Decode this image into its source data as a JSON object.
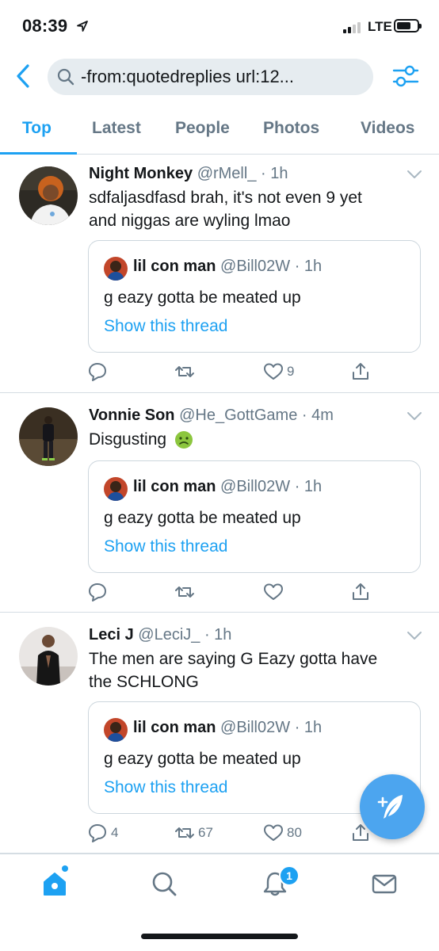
{
  "status_bar": {
    "time": "08:39",
    "network": "LTE",
    "signal_bars": 2,
    "signal_bars_max": 4
  },
  "search": {
    "query": "-from:quotedreplies url:12..."
  },
  "tabs": [
    {
      "label": "Top",
      "active": true
    },
    {
      "label": "Latest",
      "active": false
    },
    {
      "label": "People",
      "active": false
    },
    {
      "label": "Photos",
      "active": false
    },
    {
      "label": "Videos",
      "active": false
    }
  ],
  "tweets": [
    {
      "name": "Night Monkey",
      "handle": "@rMell_",
      "time": "· 1h",
      "lines": [
        "sdfaljasdfasd brah, it's not even 9 yet",
        "and niggas are wyling lmao"
      ],
      "quote": {
        "name": "lil con man",
        "handle": "@Bill02W",
        "time": "· 1h",
        "text": "g eazy gotta be meated up",
        "link": "Show this thread"
      },
      "replies": "",
      "retweets": "",
      "likes": "9"
    },
    {
      "name": "Vonnie Son",
      "handle": "@He_GottGame",
      "time": "· 4m",
      "lines": [
        "Disgusting"
      ],
      "quote": {
        "name": "lil con man",
        "handle": "@Bill02W",
        "time": "· 1h",
        "text": "g eazy gotta be meated up",
        "link": "Show this thread"
      },
      "replies": "",
      "retweets": "",
      "likes": ""
    },
    {
      "name": "Leci J",
      "handle": "@LeciJ_",
      "time": "· 1h",
      "lines": [
        "The men are saying G Eazy gotta have",
        "the SCHLONG"
      ],
      "quote": {
        "name": "lil con man",
        "handle": "@Bill02W",
        "time": "· 1h",
        "text": "g eazy gotta be meated up",
        "link": "Show this thread"
      },
      "replies": "4",
      "retweets": "67",
      "likes": "80"
    }
  ],
  "bottom_nav": {
    "notifications_badge": "1"
  },
  "colors": {
    "accent": "#1da1f2",
    "secondary_text": "#657786",
    "border": "#ccd6dd",
    "fab": "#4ca5ef"
  }
}
